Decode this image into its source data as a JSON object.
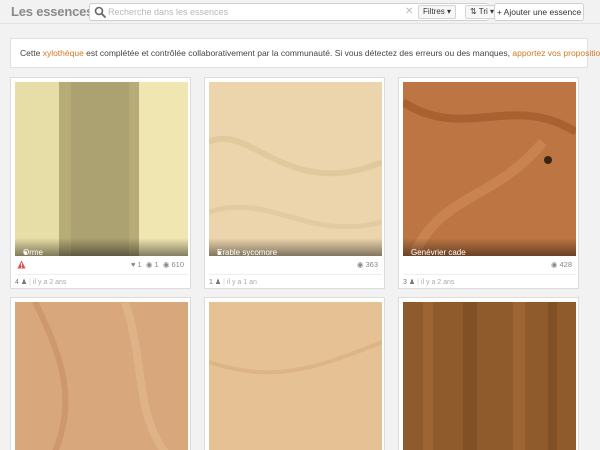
{
  "header": {
    "title": "Les essences",
    "search_placeholder": "Recherche dans les essences",
    "filter_label": "Filtres ▾",
    "sort_label": "⇅ Tri ▾",
    "add_label": "+ Ajouter une essence"
  },
  "notice": {
    "text_before": "Cette ",
    "link1": "xylothèque",
    "text_middle": " est complétée et contrôlée collaborativement par la communauté. Si vous détectez des erreurs ou des manques, ",
    "link2": "apportez vos propositions",
    "text_after": " !"
  },
  "cards": [
    {
      "name": "Orme",
      "pin": "●",
      "likes": "1",
      "comments": "1",
      "views": "610",
      "contributors": "4",
      "ago": "il y a 2 ans",
      "warning": true,
      "color": "#d8cf9a"
    },
    {
      "name": "Erable sycomore",
      "pin": "●",
      "likes": "",
      "comments": "",
      "views": "363",
      "contributors": "1",
      "ago": "il y a 1 an",
      "warning": false,
      "color": "#e3c79c"
    },
    {
      "name": "Genévrier cade",
      "pin": "",
      "likes": "",
      "comments": "",
      "views": "428",
      "contributors": "3",
      "ago": "il y a 2 ans",
      "warning": false,
      "color": "#b7693a"
    },
    {
      "name": "",
      "color": "#d9a77c"
    },
    {
      "name": "",
      "color": "#e6c193"
    },
    {
      "name": "",
      "color": "#8f5a2c"
    }
  ]
}
